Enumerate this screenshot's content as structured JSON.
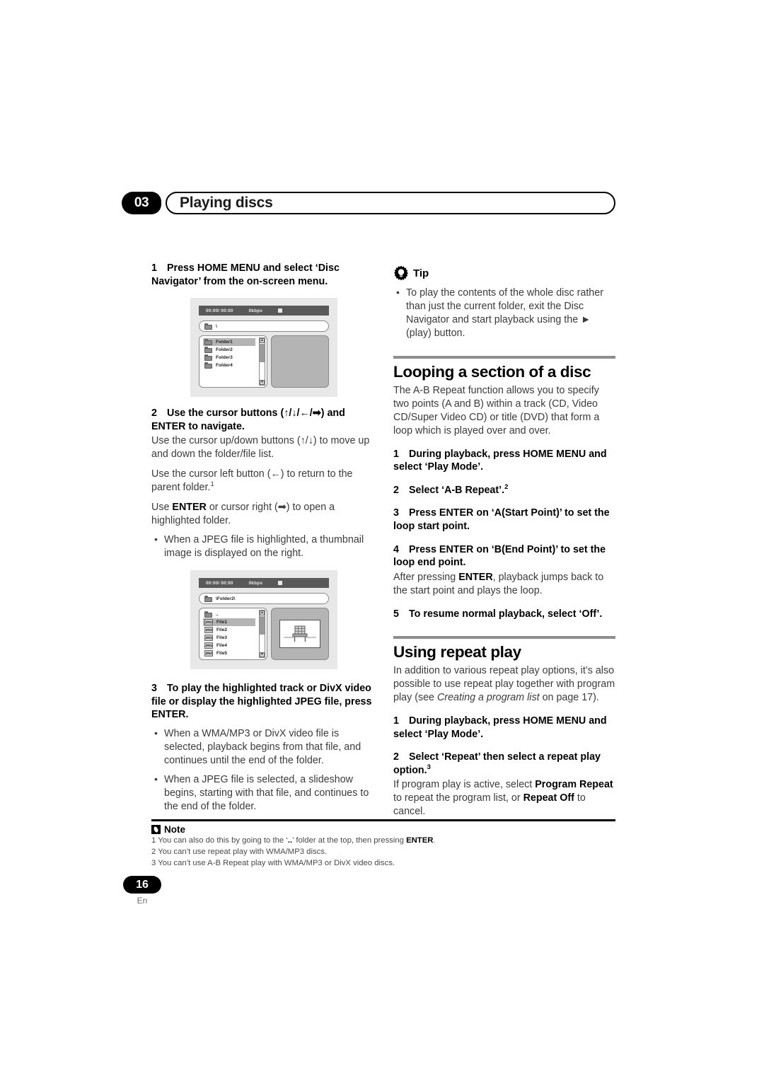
{
  "header": {
    "chapter_number": "03",
    "chapter_title": "Playing discs"
  },
  "left_column": {
    "step1": {
      "number": "1",
      "text": "Press HOME MENU and select ‘Disc Navigator’ from the on-screen menu."
    },
    "screenshot1": {
      "status_time": "00:00/ 00:00",
      "status_bitrate": "0kbps",
      "path": "\\",
      "items": [
        "Folder1",
        "Folder2",
        "Folder3",
        "Folder4"
      ],
      "selected_index": 0
    },
    "step2": {
      "number": "2",
      "text": "Use the cursor buttons (↑/↓/←/➡) and ENTER to navigate."
    },
    "step2_body1": "Use the cursor up/down buttons (↑/↓) to move up and down the folder/file list.",
    "step2_body2": "Use the cursor left button (←) to return to the parent folder.",
    "step2_body2_footnote": "1",
    "step2_body3_pre": "Use ",
    "step2_body3_bold": "ENTER",
    "step2_body3_post": " or cursor right (➡) to open a highlighted folder.",
    "step2_bullet1": "When a JPEG file is highlighted, a thumbnail image is displayed on the right.",
    "screenshot2": {
      "status_time": "00:00/ 00:00",
      "status_bitrate": "0kbps",
      "path": "\\Folder2\\",
      "parent_entry": "..",
      "items": [
        "File1",
        "File2",
        "File3",
        "File4",
        "File5"
      ],
      "file_type_label": "JPEG",
      "selected_index": 0
    },
    "step3": {
      "number": "3",
      "text": "To play the highlighted track or DivX video file or display the highlighted JPEG file, press ENTER."
    },
    "step3_bullet1": "When a WMA/MP3 or DivX video file is selected, playback begins from that file, and continues until the end of the folder.",
    "step3_bullet2": "When a JPEG file is selected, a slideshow begins, starting with that file, and continues to the end of the folder."
  },
  "right_column": {
    "tip": {
      "label": "Tip",
      "bullet": "To play the contents of the whole disc rather than just the current folder, exit the Disc Navigator and start playback using the ► (play) button."
    },
    "section_loop": {
      "title": "Looping a section of a disc",
      "intro": "The A-B Repeat function allows you to specify two points (A and B) within a track (CD, Video CD/Super Video CD) or title (DVD) that form a loop which is played over and over.",
      "step1_number": "1",
      "step1_text": "During playback, press HOME MENU and select ‘Play Mode’.",
      "step2_number": "2",
      "step2_text": "Select ‘A-B Repeat’.",
      "step2_footnote": "2",
      "step3_number": "3",
      "step3_text": "Press ENTER on ‘A(Start Point)’ to set the loop start point.",
      "step4_number": "4",
      "step4_text": "Press ENTER on ‘B(End Point)’ to set the loop end point.",
      "step4_body_pre": "After pressing ",
      "step4_body_bold": "ENTER",
      "step4_body_post": ", playback jumps back to the start point and plays the loop.",
      "step5_number": "5",
      "step5_text": "To resume normal playback, select ‘Off’."
    },
    "section_repeat": {
      "title": "Using repeat play",
      "intro_pre": "In addition to various repeat play options, it’s also possible to use repeat play together with program play (see ",
      "intro_italic": "Creating a program list",
      "intro_post": " on page 17).",
      "step1_number": "1",
      "step1_text": "During playback, press HOME MENU and select ‘Play Mode’.",
      "step2_number": "2",
      "step2_text": "Select ‘Repeat’ then select a repeat play option.",
      "step2_footnote": "3",
      "step2_body_a": "If program play is active, select ",
      "step2_body_b": "Program Repeat",
      "step2_body_c": " to repeat the program list, or ",
      "step2_body_d": "Repeat Off",
      "step2_body_e": " to cancel."
    }
  },
  "notes": {
    "label": "Note",
    "items": [
      {
        "num": "1",
        "pre": "You can also do this by going to the ‘",
        "bold_mid": "..",
        "mid": "’ folder at the top, then pressing ",
        "bold_end": "ENTER",
        "post": "."
      },
      {
        "num": "2",
        "pre": "You can’t use repeat play with WMA/MP3 discs.",
        "bold_mid": "",
        "mid": "",
        "bold_end": "",
        "post": ""
      },
      {
        "num": "3",
        "pre": "You can’t use A-B Repeat play with WMA/MP3 or DivX video discs.",
        "bold_mid": "",
        "mid": "",
        "bold_end": "",
        "post": ""
      }
    ]
  },
  "footer": {
    "page_number": "16",
    "language": "En"
  },
  "colors": {
    "accent_black": "#000000",
    "section_rule": "#8e8e8e",
    "body_gray": "#3b3b3b",
    "shot_bg": "#e8e8e8",
    "shot_status_bg": "#595959",
    "selection_gray": "#b4b4b4"
  }
}
